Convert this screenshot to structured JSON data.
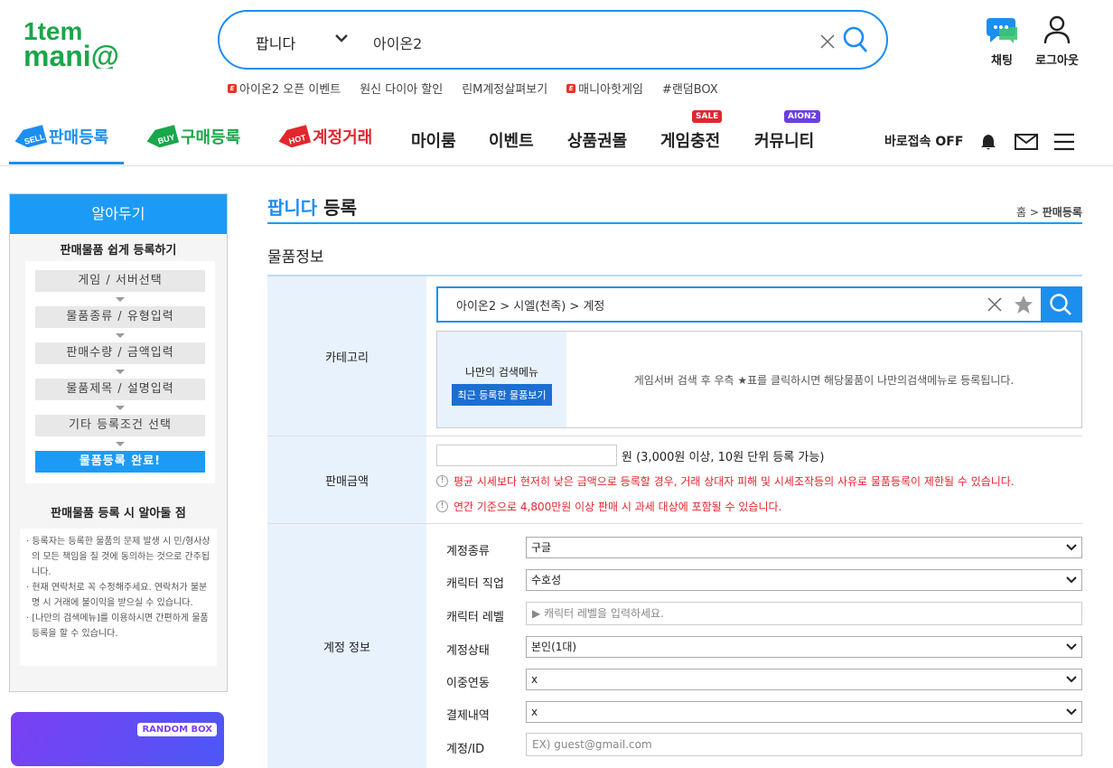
{
  "header": {
    "logo_text": "itemmania",
    "search": {
      "category": "팝니다",
      "query": "아이온2"
    },
    "keywords": [
      {
        "label": "아이온2 오픈 이벤트",
        "badge": true
      },
      {
        "label": "원신 다이아 할인",
        "badge": false
      },
      {
        "label": "린M계정살펴보기",
        "badge": false
      },
      {
        "label": "매니아핫게임",
        "badge": true
      },
      {
        "label": "#랜덤BOX",
        "badge": false
      }
    ],
    "chat_label": "채팅",
    "logout_label": "로그아웃"
  },
  "nav": {
    "sell": "판매등록",
    "buy": "구매등록",
    "account": "계정거래",
    "myroom": "마이룸",
    "event": "이벤트",
    "giftcard": "상품권몰",
    "recharge": "게임충전",
    "community": "커뮤니티",
    "sale_badge": "SALE",
    "aion_badge": "AION2",
    "direct_access": "바로접속 OFF"
  },
  "sidebar": {
    "title": "알아두기",
    "subtitle": "판매물품 쉽게 등록하기",
    "steps": [
      "게임 / 서버선택",
      "물품종류 / 유형입력",
      "판매수량 / 금액입력",
      "물품제목 / 설명입력",
      "기타 등록조건 선택",
      "물품등록 완료!"
    ],
    "notes_title": "판매물품 등록 시 알아둘 점",
    "notes": [
      "· 등록자는 등록한 물품의 문제 발생 시 민/형사상의 모든 책임을 질 것에 동의하는 것으로 간주됩니다.",
      "· 현재 연락처로 꼭 수정해주세요. 연락처가 불분명 시 거래에 불이익을 받으실 수 있습니다.",
      "· [나만의 검색메뉴]를 이용하시면 간편하게 물품등록을 할 수 있습니다."
    ],
    "banner_label": "RANDOM BOX"
  },
  "main": {
    "title_prefix": "팝니다",
    "title_suffix": " 등록",
    "breadcrumb_home": "홈 > ",
    "breadcrumb_current": "판매등록",
    "section": "물품정보",
    "category": {
      "label": "카테고리",
      "path": "아이온2 > 시엘(천족) > 계정",
      "mymenu_title": "나만의 검색메뉴",
      "mymenu_button": "최근 등록한 물품보기",
      "mymenu_hint": "게임서버 검색 후 우측 ★표를 클릭하시면 해당물품이 나만의검색메뉴로 등록됩니다."
    },
    "price": {
      "label": "판매금액",
      "unit": "원 (3,000원 이상, 10원 단위 등록 가능)",
      "warn1": "평균 시세보다 현저히 낮은 금액으로 등록할 경우, 거래 상대자 피해 및 시세조작등의 사유로 물품등록이 제한될 수 있습니다.",
      "warn2": "연간 기준으로 4,800만원 이상 판매 시 과세 대상에 포함될 수 있습니다."
    },
    "account": {
      "label": "계정 정보",
      "type_label": "계정종류",
      "type_value": "구글",
      "job_label": "캐릭터 직업",
      "job_value": "수호성",
      "level_label": "캐릭터 레벨",
      "level_placeholder": "▶ 캐릭터 레벨을 입력하세요.",
      "status_label": "계정상태",
      "status_value": "본인(1대)",
      "dual_label": "이중연동",
      "dual_value": "x",
      "payment_label": "결제내역",
      "payment_value": "x",
      "id_label": "계정/ID",
      "id_placeholder": "EX) guest@gmail.com"
    }
  }
}
